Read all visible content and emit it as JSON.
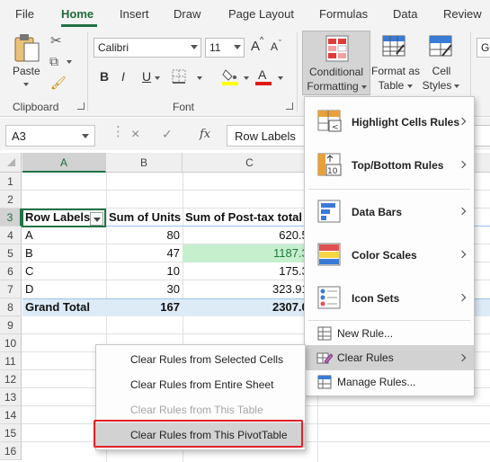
{
  "ribbon": {
    "tabs": [
      "File",
      "Home",
      "Insert",
      "Draw",
      "Page Layout",
      "Formulas",
      "Data",
      "Review"
    ],
    "active_tab": "Home",
    "clipboard": {
      "paste_label": "Paste",
      "group_label": "Clipboard"
    },
    "font": {
      "font_name": "Calibri",
      "font_size": "11",
      "group_label": "Font",
      "bold": "B",
      "italic": "I",
      "underline": "U",
      "grow": "A",
      "shrink": "A"
    },
    "styles": {
      "conditional_formatting": [
        "Conditional",
        "Formatting"
      ],
      "format_as_table": [
        "Format as",
        "Table"
      ],
      "cell_styles": [
        "Cell",
        "Styles"
      ]
    },
    "truncated_combo": "Ge",
    "accent_color": "#217346"
  },
  "formula_bar": {
    "name_box": "A3",
    "cancel": "×",
    "enter": "✓",
    "fx": "fx",
    "content": "Row Labels"
  },
  "grid": {
    "columns": [
      "A",
      "B",
      "C"
    ],
    "rows": [
      "1",
      "2",
      "3",
      "4",
      "5",
      "6",
      "7",
      "8",
      "9",
      "10",
      "11",
      "12",
      "13",
      "14",
      "15",
      "16"
    ],
    "header": {
      "a": "Row Labels",
      "b": "Sum of Units",
      "c": "Sum of Post-tax total"
    },
    "data": [
      {
        "a": "A",
        "b": "80",
        "c": "620.50"
      },
      {
        "a": "B",
        "b": "47",
        "c": "1187.36"
      },
      {
        "a": "C",
        "b": "10",
        "c": "175.30"
      },
      {
        "a": "D",
        "b": "30",
        "c": "323.914"
      }
    ],
    "total": {
      "a": "Grand Total",
      "b": "167",
      "c": "2307.08"
    },
    "highlight_color": "#c6efce"
  },
  "cf_menu": {
    "items": [
      {
        "label": "Highlight Cells Rules"
      },
      {
        "label": "Top/Bottom Rules"
      },
      {
        "label": "Data Bars"
      },
      {
        "label": "Color Scales"
      },
      {
        "label": "Icon Sets"
      },
      {
        "label": "New Rule..."
      },
      {
        "label": "Clear Rules"
      },
      {
        "label": "Manage Rules..."
      }
    ]
  },
  "clear_submenu": {
    "items": [
      {
        "label": "Clear Rules from Selected Cells",
        "enabled": true
      },
      {
        "label": "Clear Rules from Entire Sheet",
        "enabled": true
      },
      {
        "label": "Clear Rules from This Table",
        "enabled": false
      },
      {
        "label": "Clear Rules from This PivotTable",
        "enabled": true
      }
    ],
    "callout_color": "#e2202a"
  }
}
